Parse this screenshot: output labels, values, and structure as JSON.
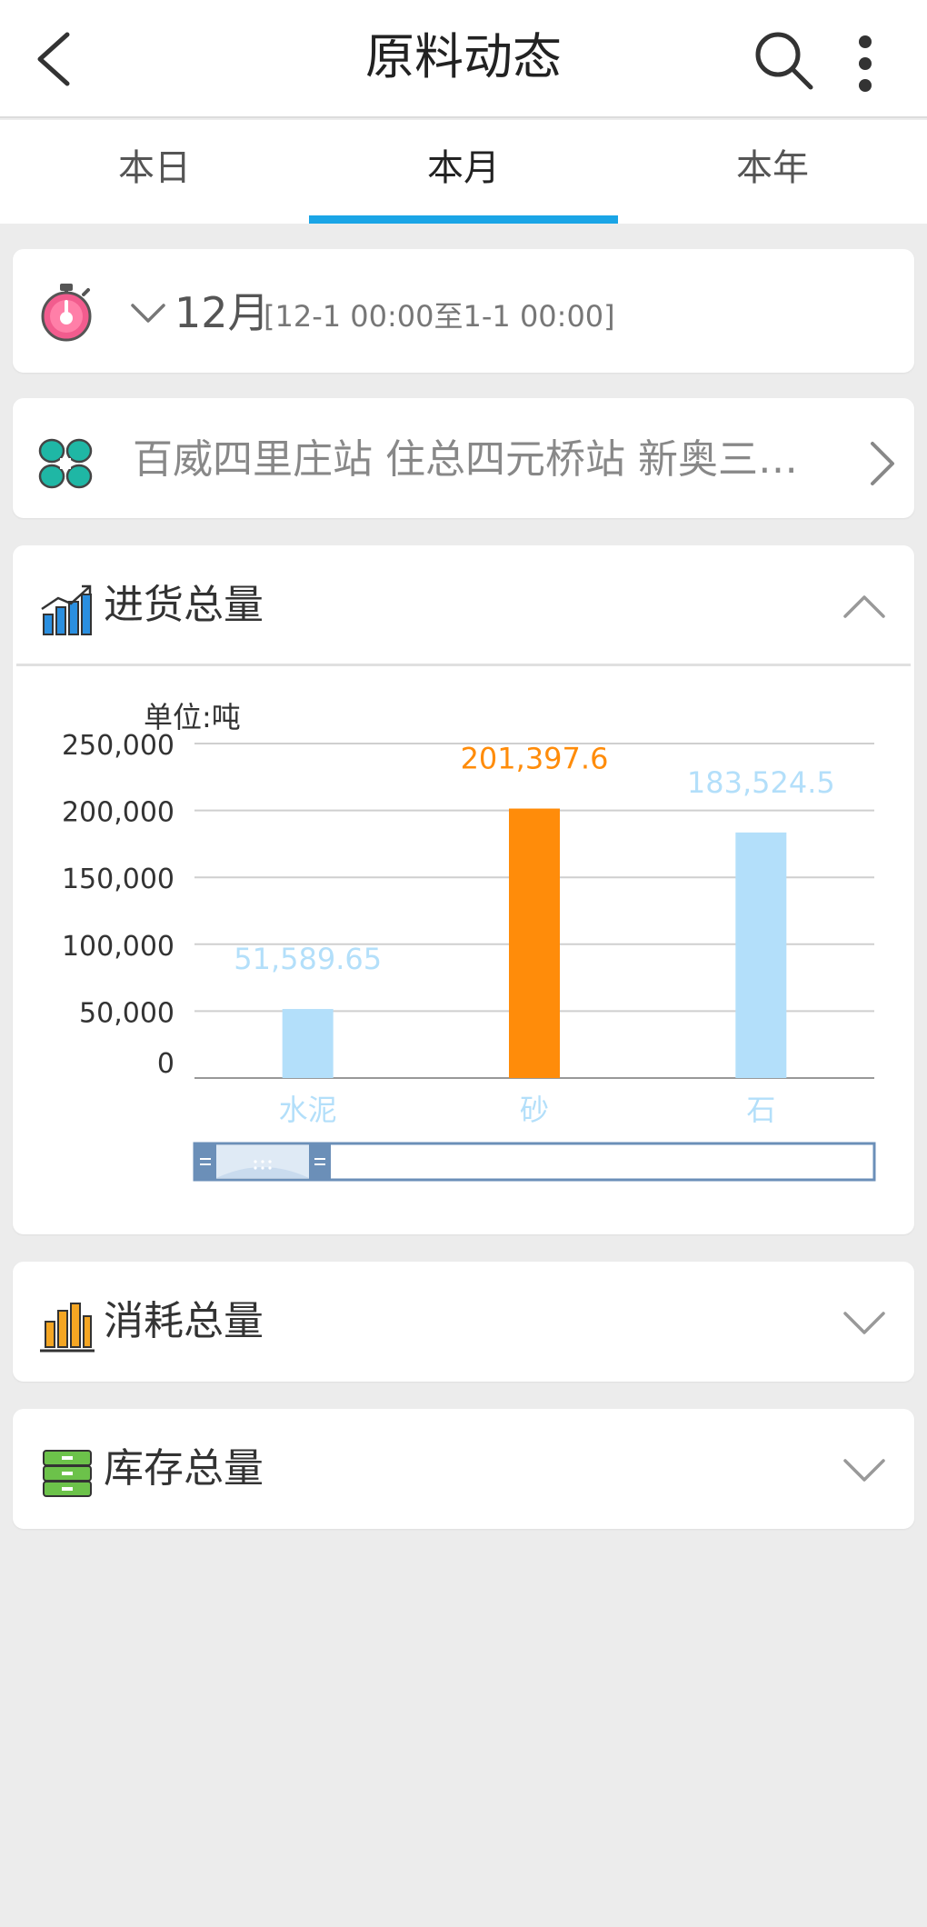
{
  "header": {
    "title": "原料动态",
    "icons": [
      "back-arrow-icon",
      "search-icon",
      "more-vertical-icon"
    ]
  },
  "tabs": [
    {
      "label": "本日",
      "active": false
    },
    {
      "label": "本月",
      "active": true
    },
    {
      "label": "本年",
      "active": false
    }
  ],
  "period": {
    "month": "12月",
    "range": "[12-1 00:00至1-1 00:00]"
  },
  "stations": {
    "text": "百威四里庄站 住总四元桥站 新奥三…"
  },
  "sections": {
    "incoming": {
      "title": "进货总量",
      "expanded": true
    },
    "consume": {
      "title": "消耗总量",
      "expanded": false
    },
    "stock": {
      "title": "库存总量",
      "expanded": false
    }
  },
  "colors": {
    "accent": "#1aa5e6",
    "bar_default": "#b3dffa",
    "bar_highlight": "#ff8c0a"
  },
  "chart_data": {
    "type": "bar",
    "unit_label": "单位:吨",
    "categories": [
      "水泥",
      "砂",
      "石"
    ],
    "values": [
      51589.65,
      201397.6,
      183524.5
    ],
    "value_labels": [
      "51,589.65",
      "201,397.6",
      "183,524.5"
    ],
    "highlight_index": 1,
    "y_ticks": [
      "250,000",
      "200,000",
      "150,000",
      "100,000",
      "50,000",
      "0"
    ],
    "ylim": [
      0,
      250000
    ],
    "grid": true,
    "zoom_slider": true
  }
}
